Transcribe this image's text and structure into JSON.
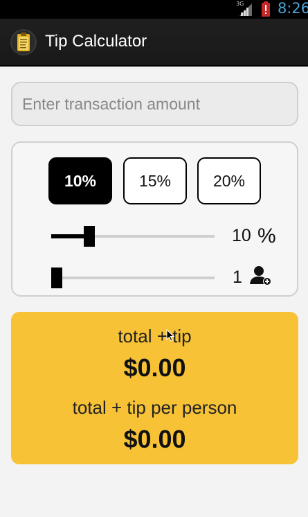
{
  "status_bar": {
    "network": "3G",
    "time": "8:26"
  },
  "action_bar": {
    "title": "Tip Calculator",
    "icon": "clipboard-icon"
  },
  "amount": {
    "placeholder": "Enter transaction amount",
    "value": ""
  },
  "tip_buttons": [
    {
      "label": "10%",
      "selected": true
    },
    {
      "label": "15%",
      "selected": false
    },
    {
      "label": "20%",
      "selected": false
    }
  ],
  "tip_slider": {
    "value": "10",
    "unit": "%",
    "level": 0.2
  },
  "people_slider": {
    "value": "1",
    "icon": "add-person-icon",
    "level": 0.0
  },
  "results": {
    "total_tip_label": "total + tip",
    "total_tip_value": "$0.00",
    "per_person_label": "total + tip per person",
    "per_person_value": "$0.00"
  },
  "colors": {
    "result_background": "#f7c235",
    "action_bar": "#1f1f1f",
    "clock": "#4aa3d6"
  }
}
